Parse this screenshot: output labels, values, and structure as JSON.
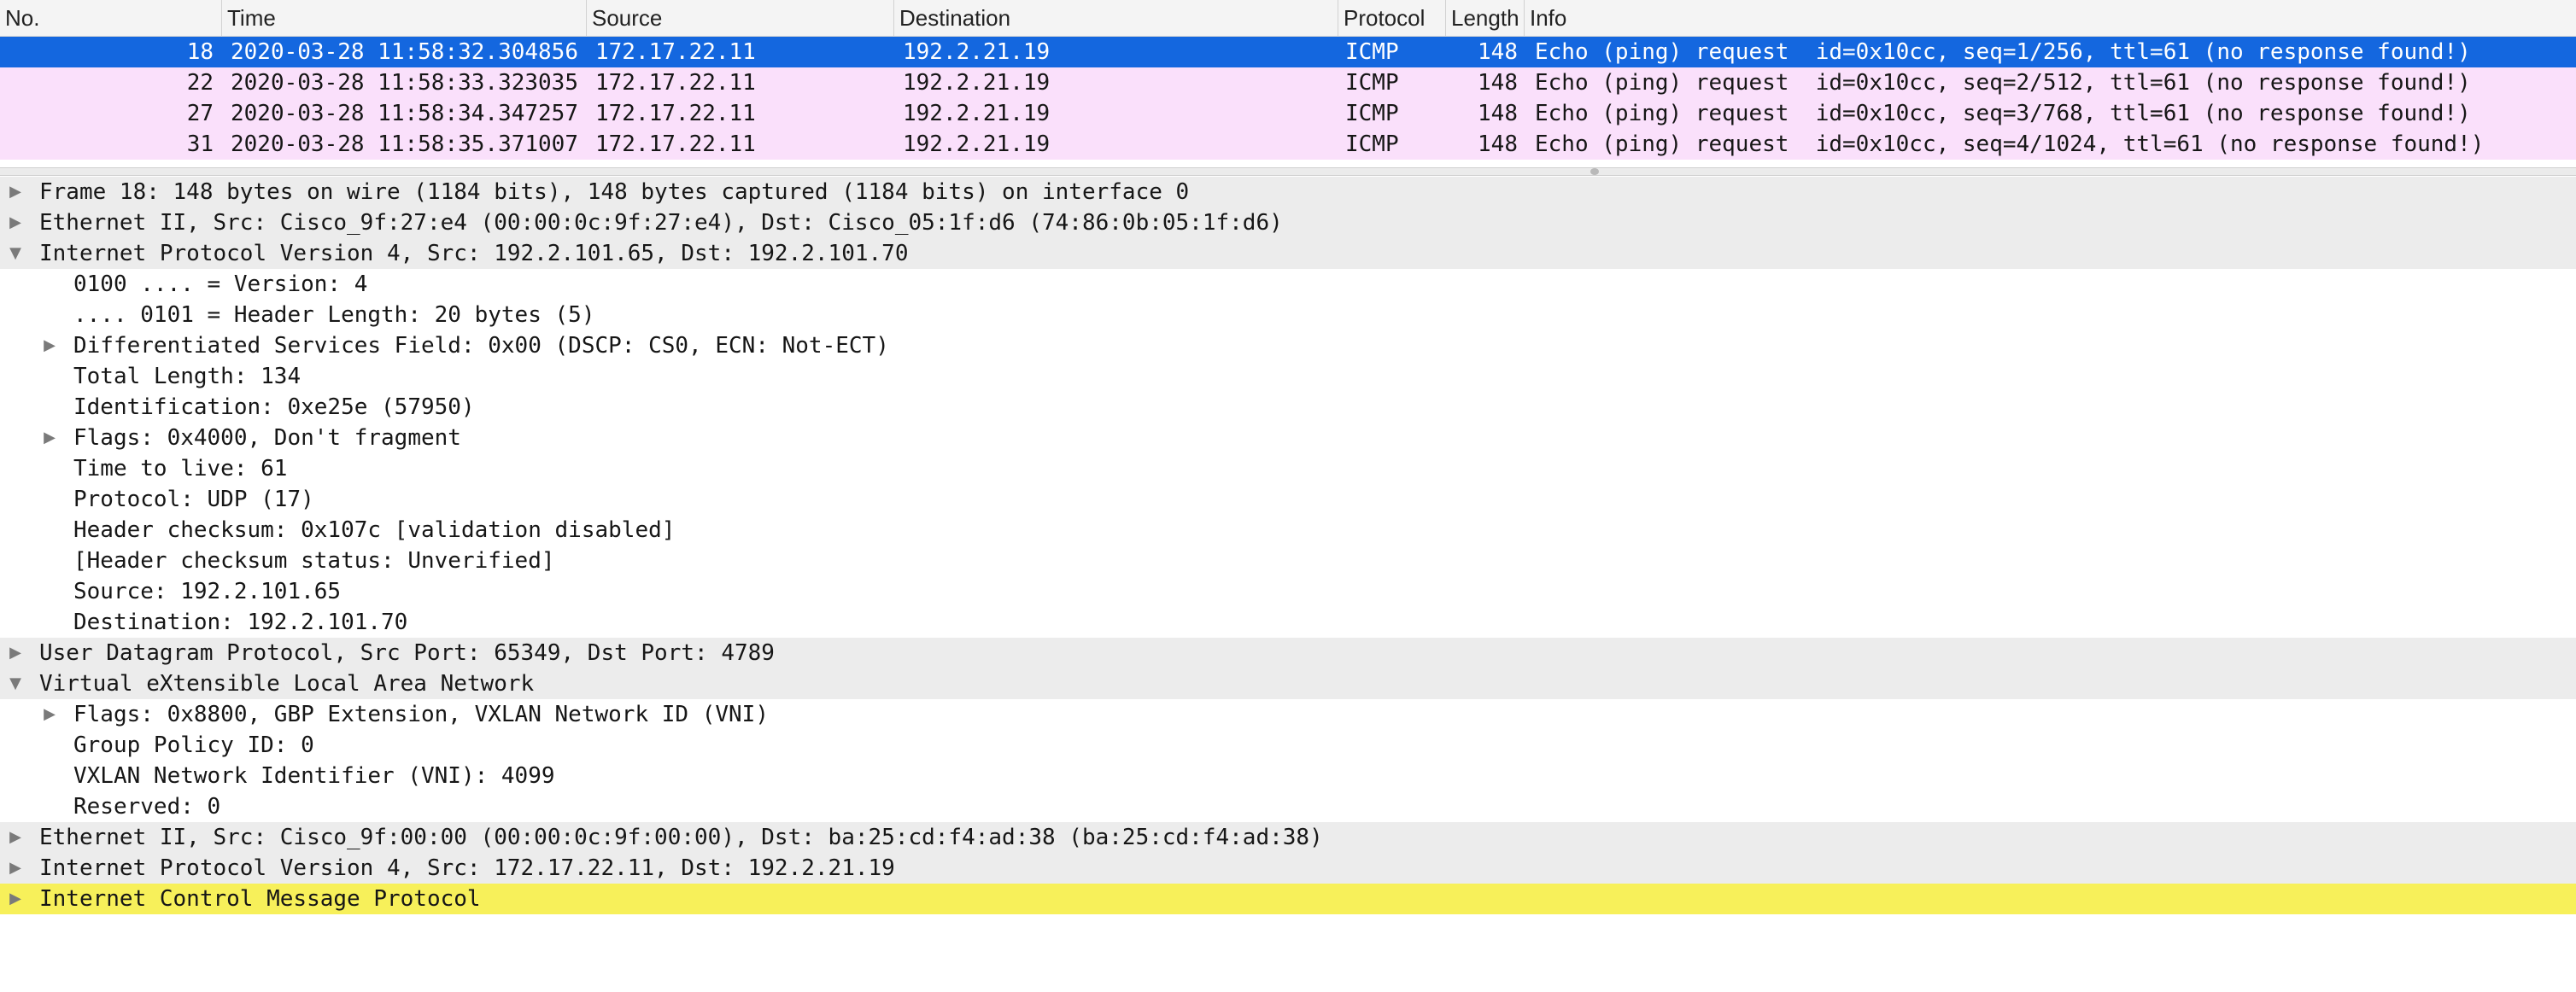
{
  "packet_list": {
    "columns": [
      "No.",
      "Time",
      "Source",
      "Destination",
      "Protocol",
      "Length",
      "Info"
    ],
    "rows": [
      {
        "no": "18",
        "time": "2020-03-28 11:58:32.304856",
        "source": "172.17.22.11",
        "destination": "192.2.21.19",
        "protocol": "ICMP",
        "length": "148",
        "info": "Echo (ping) request  id=0x10cc, seq=1/256, ttl=61 (no response found!)",
        "selected": true
      },
      {
        "no": "22",
        "time": "2020-03-28 11:58:33.323035",
        "source": "172.17.22.11",
        "destination": "192.2.21.19",
        "protocol": "ICMP",
        "length": "148",
        "info": "Echo (ping) request  id=0x10cc, seq=2/512, ttl=61 (no response found!)",
        "selected": false
      },
      {
        "no": "27",
        "time": "2020-03-28 11:58:34.347257",
        "source": "172.17.22.11",
        "destination": "192.2.21.19",
        "protocol": "ICMP",
        "length": "148",
        "info": "Echo (ping) request  id=0x10cc, seq=3/768, ttl=61 (no response found!)",
        "selected": false
      },
      {
        "no": "31",
        "time": "2020-03-28 11:58:35.371007",
        "source": "172.17.22.11",
        "destination": "192.2.21.19",
        "protocol": "ICMP",
        "length": "148",
        "info": "Echo (ping) request  id=0x10cc, seq=4/1024, ttl=61 (no response found!)",
        "selected": false
      }
    ]
  },
  "details": [
    {
      "level": 0,
      "expandable": true,
      "expanded": false,
      "text": "Frame 18: 148 bytes on wire (1184 bits), 148 bytes captured (1184 bits) on interface 0"
    },
    {
      "level": 0,
      "expandable": true,
      "expanded": false,
      "text": "Ethernet II, Src: Cisco_9f:27:e4 (00:00:0c:9f:27:e4), Dst: Cisco_05:1f:d6 (74:86:0b:05:1f:d6)"
    },
    {
      "level": 0,
      "expandable": true,
      "expanded": true,
      "text": "Internet Protocol Version 4, Src: 192.2.101.65, Dst: 192.2.101.70"
    },
    {
      "level": 1,
      "expandable": false,
      "expanded": false,
      "text": "0100 .... = Version: 4"
    },
    {
      "level": 1,
      "expandable": false,
      "expanded": false,
      "text": ".... 0101 = Header Length: 20 bytes (5)"
    },
    {
      "level": 1,
      "expandable": true,
      "expanded": false,
      "text": "Differentiated Services Field: 0x00 (DSCP: CS0, ECN: Not-ECT)"
    },
    {
      "level": 1,
      "expandable": false,
      "expanded": false,
      "text": "Total Length: 134"
    },
    {
      "level": 1,
      "expandable": false,
      "expanded": false,
      "text": "Identification: 0xe25e (57950)"
    },
    {
      "level": 1,
      "expandable": true,
      "expanded": false,
      "text": "Flags: 0x4000, Don't fragment"
    },
    {
      "level": 1,
      "expandable": false,
      "expanded": false,
      "text": "Time to live: 61"
    },
    {
      "level": 1,
      "expandable": false,
      "expanded": false,
      "text": "Protocol: UDP (17)"
    },
    {
      "level": 1,
      "expandable": false,
      "expanded": false,
      "text": "Header checksum: 0x107c [validation disabled]"
    },
    {
      "level": 1,
      "expandable": false,
      "expanded": false,
      "text": "[Header checksum status: Unverified]"
    },
    {
      "level": 1,
      "expandable": false,
      "expanded": false,
      "text": "Source: 192.2.101.65"
    },
    {
      "level": 1,
      "expandable": false,
      "expanded": false,
      "text": "Destination: 192.2.101.70"
    },
    {
      "level": 0,
      "expandable": true,
      "expanded": false,
      "text": "User Datagram Protocol, Src Port: 65349, Dst Port: 4789"
    },
    {
      "level": 0,
      "expandable": true,
      "expanded": true,
      "text": "Virtual eXtensible Local Area Network"
    },
    {
      "level": 1,
      "expandable": true,
      "expanded": false,
      "text": "Flags: 0x8800, GBP Extension, VXLAN Network ID (VNI)"
    },
    {
      "level": 1,
      "expandable": false,
      "expanded": false,
      "text": "Group Policy ID: 0"
    },
    {
      "level": 1,
      "expandable": false,
      "expanded": false,
      "text": "VXLAN Network Identifier (VNI): 4099"
    },
    {
      "level": 1,
      "expandable": false,
      "expanded": false,
      "text": "Reserved: 0"
    },
    {
      "level": 0,
      "expandable": true,
      "expanded": false,
      "text": "Ethernet II, Src: Cisco_9f:00:00 (00:00:0c:9f:00:00), Dst: ba:25:cd:f4:ad:38 (ba:25:cd:f4:ad:38)"
    },
    {
      "level": 0,
      "expandable": true,
      "expanded": false,
      "text": "Internet Protocol Version 4, Src: 172.17.22.11, Dst: 192.2.21.19"
    },
    {
      "level": 0,
      "expandable": true,
      "expanded": false,
      "highlight": true,
      "text": "Internet Control Message Protocol"
    }
  ],
  "icons": {
    "collapsed": "triangle-right-icon",
    "expanded": "triangle-down-icon"
  },
  "colors": {
    "selected_row": "#1467df",
    "icmp_row": "#fae0fb",
    "highlight": "#f7f05a",
    "section_bg": "#ececec"
  }
}
